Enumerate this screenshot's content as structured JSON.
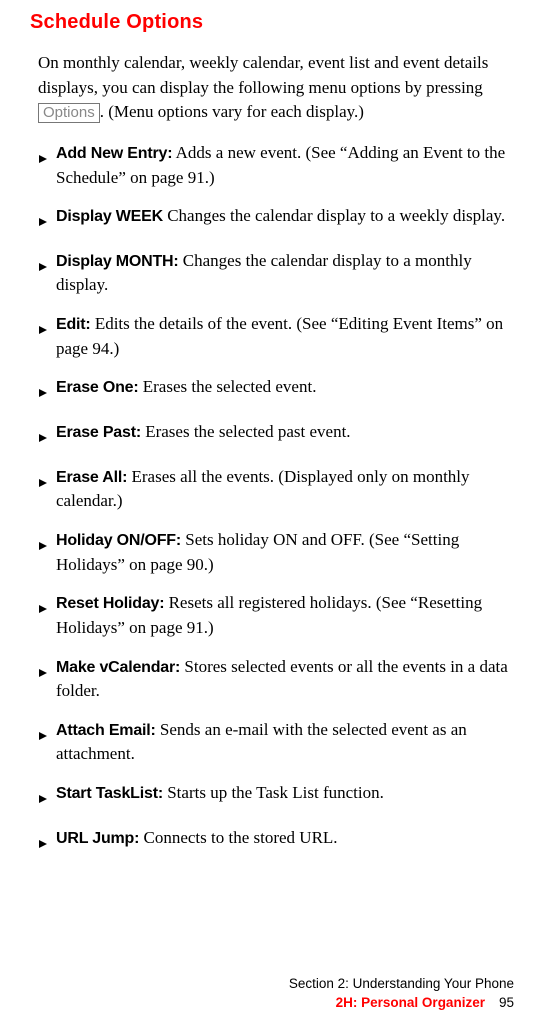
{
  "heading": "Schedule Options",
  "intro_pre": "On monthly calendar, weekly calendar, event list and event details displays, you can display the following menu options by pressing ",
  "intro_box": "Options",
  "intro_post": ". (Menu options vary for each display.)",
  "items": [
    {
      "lead": "Add New Entry:",
      "rest": " Adds a new event. (See “Adding an Event to the Schedule” on page 91.)"
    },
    {
      "lead": "Display WEEK",
      "rest": " Changes the calendar display to a weekly display."
    },
    {
      "lead": "Display MONTH:",
      "rest": " Changes the calendar display to a monthly display."
    },
    {
      "lead": "Edit:",
      "rest": " Edits the details of the event. (See “Editing Event Items” on page 94.)"
    },
    {
      "lead": "Erase One:",
      "rest": " Erases the selected event."
    },
    {
      "lead": "Erase Past:",
      "rest": " Erases the selected past event."
    },
    {
      "lead": "Erase All:",
      "rest": " Erases all the events. (Displayed only on monthly calendar.)"
    },
    {
      "lead": "Holiday ON/OFF:",
      "rest": " Sets holiday ON and OFF. (See “Setting Holidays” on page 90.)"
    },
    {
      "lead": "Reset Holiday:",
      "rest": " Resets all registered holidays. (See “Resetting Holidays” on page 91.)"
    },
    {
      "lead": "Make vCalendar:",
      "rest": " Stores selected events or all the events in a data folder."
    },
    {
      "lead": "Attach Email:",
      "rest": " Sends an e-mail with the selected event as an attachment."
    },
    {
      "lead": "Start TaskList:",
      "rest": " Starts up the Task List function."
    },
    {
      "lead": "URL Jump:",
      "rest": " Connects to the stored URL."
    }
  ],
  "footer": {
    "line1": "Section 2: Understanding Your Phone",
    "line2": "2H: Personal Organizer",
    "page": "95"
  }
}
